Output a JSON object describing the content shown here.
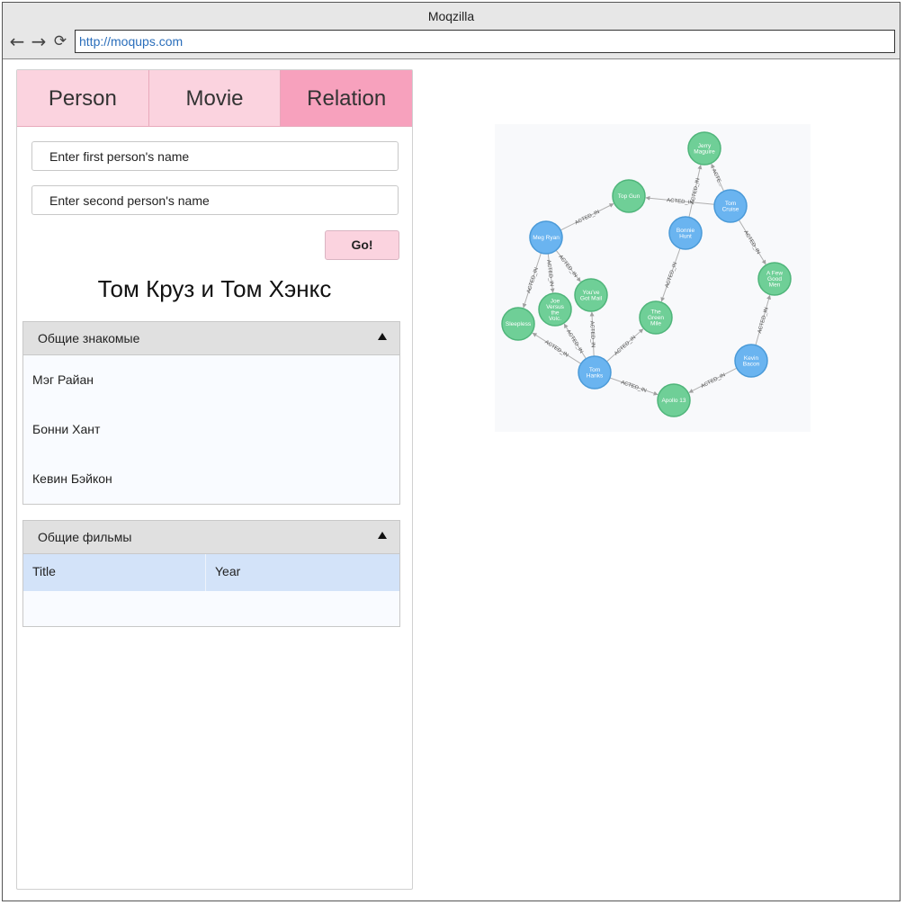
{
  "window": {
    "title": "Moqzilla"
  },
  "browser": {
    "back_icon": "←",
    "forward_icon": "→",
    "reload_icon": "⟳",
    "url": "http://moqups.com"
  },
  "tabs": [
    {
      "label": "Person",
      "active": false
    },
    {
      "label": "Movie",
      "active": false
    },
    {
      "label": "Relation",
      "active": true
    }
  ],
  "form": {
    "first_placeholder": "Enter first person's name",
    "second_placeholder": "Enter second person's name",
    "go_label": "Go!"
  },
  "result": {
    "heading": "Том Круз и Том Хэнкс",
    "common_acquaintances": {
      "title": "Общие знакомые",
      "items": [
        "Мэг Райан",
        "Бонни Хант",
        "Кевин Бэйкон"
      ]
    },
    "common_movies": {
      "title": "Общие фильмы",
      "columns": [
        "Title",
        "Year"
      ],
      "rows": []
    }
  },
  "graph": {
    "colors": {
      "person": "#6ab4f0",
      "movie": "#6fcf97",
      "edge": "#b0b0b0",
      "text": "#ffffff"
    },
    "nodes": [
      {
        "id": "jerry",
        "label": "Jerry\nMaguire",
        "kind": "movie"
      },
      {
        "id": "topgun",
        "label": "Top Gun",
        "kind": "movie"
      },
      {
        "id": "tomcruise",
        "label": "Tom\nCruise",
        "kind": "person"
      },
      {
        "id": "megryan",
        "label": "Meg Ryan",
        "kind": "person"
      },
      {
        "id": "bonnie",
        "label": "Bonnie\nHunt",
        "kind": "person"
      },
      {
        "id": "afew",
        "label": "A Few\nGood\nMen",
        "kind": "movie"
      },
      {
        "id": "joe",
        "label": "Joe\nVersus\nthe\nVolc.",
        "kind": "movie"
      },
      {
        "id": "yougot",
        "label": "You've\nGot Mail",
        "kind": "movie"
      },
      {
        "id": "sleepless",
        "label": "Sleepless",
        "kind": "movie"
      },
      {
        "id": "greenmile",
        "label": "The\nGreen\nMile",
        "kind": "movie"
      },
      {
        "id": "kevin",
        "label": "Kevin\nBacon",
        "kind": "person"
      },
      {
        "id": "tomhanks",
        "label": "Tom\nHanks",
        "kind": "person"
      },
      {
        "id": "apollo",
        "label": "Apollo 13",
        "kind": "movie"
      }
    ],
    "edges": [
      {
        "from": "tomcruise",
        "to": "jerry",
        "label": "ACTE..."
      },
      {
        "from": "tomcruise",
        "to": "topgun",
        "label": "ACTED_IN"
      },
      {
        "from": "bonnie",
        "to": "jerry",
        "label": "ACTED_IN"
      },
      {
        "from": "megryan",
        "to": "topgun",
        "label": "ACTED_IN"
      },
      {
        "from": "tomcruise",
        "to": "afew",
        "label": "ACTED_IN"
      },
      {
        "from": "megryan",
        "to": "sleepless",
        "label": "ACTED_IN"
      },
      {
        "from": "megryan",
        "to": "joe",
        "label": "ACTED_IN"
      },
      {
        "from": "megryan",
        "to": "yougot",
        "label": "ACTED_IN"
      },
      {
        "from": "bonnie",
        "to": "greenmile",
        "label": "ACTED_IN"
      },
      {
        "from": "tomhanks",
        "to": "sleepless",
        "label": "ACTED_IN"
      },
      {
        "from": "tomhanks",
        "to": "joe",
        "label": "ACTED_IN"
      },
      {
        "from": "tomhanks",
        "to": "yougot",
        "label": "ACTED_IN"
      },
      {
        "from": "tomhanks",
        "to": "greenmile",
        "label": "ACTED_IN"
      },
      {
        "from": "tomhanks",
        "to": "apollo",
        "label": "ACTED_IN"
      },
      {
        "from": "kevin",
        "to": "apollo",
        "label": "ACTED_IN"
      },
      {
        "from": "kevin",
        "to": "afew",
        "label": "ACTED_IN"
      }
    ]
  }
}
